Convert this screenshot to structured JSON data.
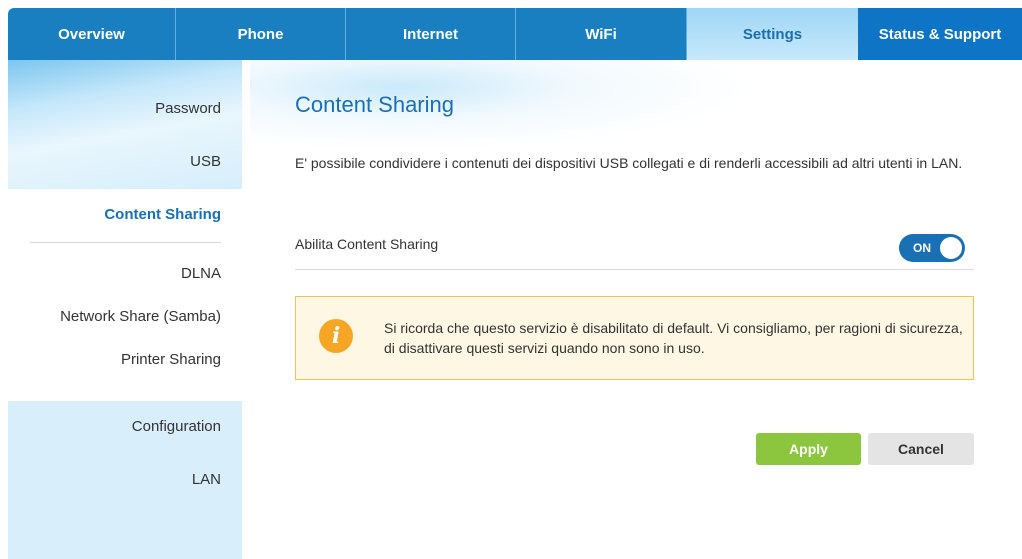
{
  "nav": {
    "tabs": [
      {
        "label": "Overview"
      },
      {
        "label": "Phone"
      },
      {
        "label": "Internet"
      },
      {
        "label": "WiFi"
      },
      {
        "label": "Settings"
      },
      {
        "label": "Status & Support"
      }
    ],
    "active": "Settings"
  },
  "sidebar": {
    "items": [
      {
        "label": "Password"
      },
      {
        "label": "USB"
      },
      {
        "label": "Content Sharing"
      },
      {
        "label": "DLNA"
      },
      {
        "label": "Network Share (Samba)"
      },
      {
        "label": "Printer Sharing"
      },
      {
        "label": "Configuration"
      },
      {
        "label": "LAN"
      }
    ],
    "active": "Content Sharing"
  },
  "main": {
    "title": "Content Sharing",
    "description": "E' possibile condividere i contenuti dei dispositivi USB collegati e di renderli accessibili ad altri utenti in LAN.",
    "toggle": {
      "label": "Abilita Content Sharing",
      "state": "ON"
    },
    "notice": {
      "icon": "info-icon",
      "icon_glyph": "i",
      "text": "Si ricorda che questo servizio è disabilitato di default. Vi consigliamo, per ragioni di sicurezza, di disattivare questi servizi quando non sono in uso."
    },
    "buttons": {
      "apply": "Apply",
      "cancel": "Cancel"
    }
  },
  "colors": {
    "nav_blue": "#1a7fc1",
    "accent_blue": "#1a70b5",
    "apply_green": "#8cc63e",
    "notice_border": "#f1c15a",
    "notice_icon": "#f6a524"
  }
}
